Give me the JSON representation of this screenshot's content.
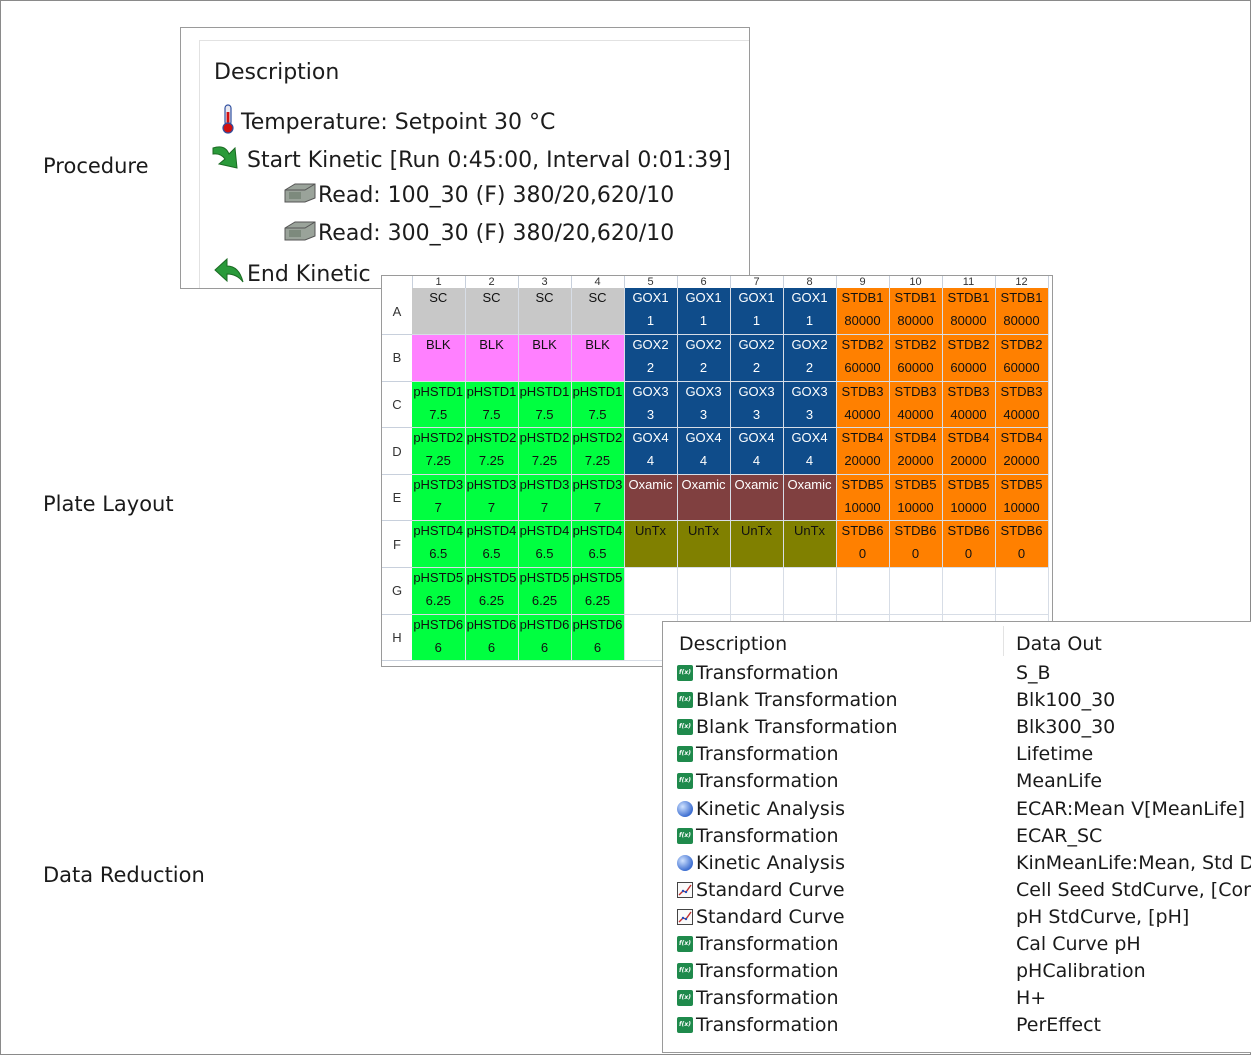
{
  "labels": {
    "procedure": "Procedure",
    "plate_layout": "Plate Layout",
    "data_reduction": "Data Reduction"
  },
  "procedure": {
    "header": "Description",
    "steps": [
      {
        "icon": "thermometer-icon",
        "text": "Temperature:  Setpoint 30 °C"
      },
      {
        "icon": "start-kinetic-arrow-icon",
        "text": "Start Kinetic [Run 0:45:00, Interval 0:01:39]"
      },
      {
        "icon": "read-icon",
        "text": "Read:  100_30 (F) 380/20,620/10"
      },
      {
        "icon": "read-icon",
        "text": "Read:  300_30 (F) 380/20,620/10"
      },
      {
        "icon": "end-kinetic-arrow-icon",
        "text": "End Kinetic"
      }
    ]
  },
  "plate": {
    "columns": [
      "1",
      "2",
      "3",
      "4",
      "5",
      "6",
      "7",
      "8",
      "9",
      "10",
      "11",
      "12"
    ],
    "rows": [
      {
        "label": "A",
        "wells": [
          {
            "l1": "SC",
            "l2": "",
            "c": "#c8c8c8"
          },
          {
            "l1": "SC",
            "l2": "",
            "c": "#c8c8c8"
          },
          {
            "l1": "SC",
            "l2": "",
            "c": "#c8c8c8"
          },
          {
            "l1": "SC",
            "l2": "",
            "c": "#c8c8c8"
          },
          {
            "l1": "GOX1",
            "l2": "1",
            "c": "#0f4c8a"
          },
          {
            "l1": "GOX1",
            "l2": "1",
            "c": "#0f4c8a"
          },
          {
            "l1": "GOX1",
            "l2": "1",
            "c": "#0f4c8a"
          },
          {
            "l1": "GOX1",
            "l2": "1",
            "c": "#0f4c8a"
          },
          {
            "l1": "STDB1",
            "l2": "80000",
            "c": "#ff8000"
          },
          {
            "l1": "STDB1",
            "l2": "80000",
            "c": "#ff8000"
          },
          {
            "l1": "STDB1",
            "l2": "80000",
            "c": "#ff8000"
          },
          {
            "l1": "STDB1",
            "l2": "80000",
            "c": "#ff8000"
          }
        ]
      },
      {
        "label": "B",
        "wells": [
          {
            "l1": "BLK",
            "l2": "",
            "c": "#ff80ff"
          },
          {
            "l1": "BLK",
            "l2": "",
            "c": "#ff80ff"
          },
          {
            "l1": "BLK",
            "l2": "",
            "c": "#ff80ff"
          },
          {
            "l1": "BLK",
            "l2": "",
            "c": "#ff80ff"
          },
          {
            "l1": "GOX2",
            "l2": "2",
            "c": "#0f4c8a"
          },
          {
            "l1": "GOX2",
            "l2": "2",
            "c": "#0f4c8a"
          },
          {
            "l1": "GOX2",
            "l2": "2",
            "c": "#0f4c8a"
          },
          {
            "l1": "GOX2",
            "l2": "2",
            "c": "#0f4c8a"
          },
          {
            "l1": "STDB2",
            "l2": "60000",
            "c": "#ff8000"
          },
          {
            "l1": "STDB2",
            "l2": "60000",
            "c": "#ff8000"
          },
          {
            "l1": "STDB2",
            "l2": "60000",
            "c": "#ff8000"
          },
          {
            "l1": "STDB2",
            "l2": "60000",
            "c": "#ff8000"
          }
        ]
      },
      {
        "label": "C",
        "wells": [
          {
            "l1": "pHSTD1",
            "l2": "7.5",
            "c": "#00ff40"
          },
          {
            "l1": "pHSTD1",
            "l2": "7.5",
            "c": "#00ff40"
          },
          {
            "l1": "pHSTD1",
            "l2": "7.5",
            "c": "#00ff40"
          },
          {
            "l1": "pHSTD1",
            "l2": "7.5",
            "c": "#00ff40"
          },
          {
            "l1": "GOX3",
            "l2": "3",
            "c": "#0f4c8a"
          },
          {
            "l1": "GOX3",
            "l2": "3",
            "c": "#0f4c8a"
          },
          {
            "l1": "GOX3",
            "l2": "3",
            "c": "#0f4c8a"
          },
          {
            "l1": "GOX3",
            "l2": "3",
            "c": "#0f4c8a"
          },
          {
            "l1": "STDB3",
            "l2": "40000",
            "c": "#ff8000"
          },
          {
            "l1": "STDB3",
            "l2": "40000",
            "c": "#ff8000"
          },
          {
            "l1": "STDB3",
            "l2": "40000",
            "c": "#ff8000"
          },
          {
            "l1": "STDB3",
            "l2": "40000",
            "c": "#ff8000"
          }
        ]
      },
      {
        "label": "D",
        "wells": [
          {
            "l1": "pHSTD2",
            "l2": "7.25",
            "c": "#00ff40"
          },
          {
            "l1": "pHSTD2",
            "l2": "7.25",
            "c": "#00ff40"
          },
          {
            "l1": "pHSTD2",
            "l2": "7.25",
            "c": "#00ff40"
          },
          {
            "l1": "pHSTD2",
            "l2": "7.25",
            "c": "#00ff40"
          },
          {
            "l1": "GOX4",
            "l2": "4",
            "c": "#0f4c8a"
          },
          {
            "l1": "GOX4",
            "l2": "4",
            "c": "#0f4c8a"
          },
          {
            "l1": "GOX4",
            "l2": "4",
            "c": "#0f4c8a"
          },
          {
            "l1": "GOX4",
            "l2": "4",
            "c": "#0f4c8a"
          },
          {
            "l1": "STDB4",
            "l2": "20000",
            "c": "#ff8000"
          },
          {
            "l1": "STDB4",
            "l2": "20000",
            "c": "#ff8000"
          },
          {
            "l1": "STDB4",
            "l2": "20000",
            "c": "#ff8000"
          },
          {
            "l1": "STDB4",
            "l2": "20000",
            "c": "#ff8000"
          }
        ]
      },
      {
        "label": "E",
        "wells": [
          {
            "l1": "pHSTD3",
            "l2": "7",
            "c": "#00ff40"
          },
          {
            "l1": "pHSTD3",
            "l2": "7",
            "c": "#00ff40"
          },
          {
            "l1": "pHSTD3",
            "l2": "7",
            "c": "#00ff40"
          },
          {
            "l1": "pHSTD3",
            "l2": "7",
            "c": "#00ff40"
          },
          {
            "l1": "Oxamic",
            "l2": "",
            "c": "#804040"
          },
          {
            "l1": "Oxamic",
            "l2": "",
            "c": "#804040"
          },
          {
            "l1": "Oxamic",
            "l2": "",
            "c": "#804040"
          },
          {
            "l1": "Oxamic",
            "l2": "",
            "c": "#804040"
          },
          {
            "l1": "STDB5",
            "l2": "10000",
            "c": "#ff8000"
          },
          {
            "l1": "STDB5",
            "l2": "10000",
            "c": "#ff8000"
          },
          {
            "l1": "STDB5",
            "l2": "10000",
            "c": "#ff8000"
          },
          {
            "l1": "STDB5",
            "l2": "10000",
            "c": "#ff8000"
          }
        ]
      },
      {
        "label": "F",
        "wells": [
          {
            "l1": "pHSTD4",
            "l2": "6.5",
            "c": "#00ff40"
          },
          {
            "l1": "pHSTD4",
            "l2": "6.5",
            "c": "#00ff40"
          },
          {
            "l1": "pHSTD4",
            "l2": "6.5",
            "c": "#00ff40"
          },
          {
            "l1": "pHSTD4",
            "l2": "6.5",
            "c": "#00ff40"
          },
          {
            "l1": "UnTx",
            "l2": "",
            "c": "#808000"
          },
          {
            "l1": "UnTx",
            "l2": "",
            "c": "#808000"
          },
          {
            "l1": "UnTx",
            "l2": "",
            "c": "#808000"
          },
          {
            "l1": "UnTx",
            "l2": "",
            "c": "#808000"
          },
          {
            "l1": "STDB6",
            "l2": "0",
            "c": "#ff8000"
          },
          {
            "l1": "STDB6",
            "l2": "0",
            "c": "#ff8000"
          },
          {
            "l1": "STDB6",
            "l2": "0",
            "c": "#ff8000"
          },
          {
            "l1": "STDB6",
            "l2": "0",
            "c": "#ff8000"
          }
        ]
      },
      {
        "label": "G",
        "wells": [
          {
            "l1": "pHSTD5",
            "l2": "6.25",
            "c": "#00ff40"
          },
          {
            "l1": "pHSTD5",
            "l2": "6.25",
            "c": "#00ff40"
          },
          {
            "l1": "pHSTD5",
            "l2": "6.25",
            "c": "#00ff40"
          },
          {
            "l1": "pHSTD5",
            "l2": "6.25",
            "c": "#00ff40"
          },
          {
            "l1": "",
            "l2": "",
            "c": "#ffffff"
          },
          {
            "l1": "",
            "l2": "",
            "c": "#ffffff"
          },
          {
            "l1": "",
            "l2": "",
            "c": "#ffffff"
          },
          {
            "l1": "",
            "l2": "",
            "c": "#ffffff"
          },
          {
            "l1": "",
            "l2": "",
            "c": "#ffffff"
          },
          {
            "l1": "",
            "l2": "",
            "c": "#ffffff"
          },
          {
            "l1": "",
            "l2": "",
            "c": "#ffffff"
          },
          {
            "l1": "",
            "l2": "",
            "c": "#ffffff"
          }
        ]
      },
      {
        "label": "H",
        "wells": [
          {
            "l1": "pHSTD6",
            "l2": "6",
            "c": "#00ff40"
          },
          {
            "l1": "pHSTD6",
            "l2": "6",
            "c": "#00ff40"
          },
          {
            "l1": "pHSTD6",
            "l2": "6",
            "c": "#00ff40"
          },
          {
            "l1": "pHSTD6",
            "l2": "6",
            "c": "#00ff40"
          },
          {
            "l1": "",
            "l2": "",
            "c": "#ffffff"
          },
          {
            "l1": "",
            "l2": "",
            "c": "#ffffff"
          },
          {
            "l1": "",
            "l2": "",
            "c": "#ffffff"
          },
          {
            "l1": "",
            "l2": "",
            "c": "#ffffff"
          },
          {
            "l1": "",
            "l2": "",
            "c": "#ffffff"
          },
          {
            "l1": "",
            "l2": "",
            "c": "#ffffff"
          },
          {
            "l1": "",
            "l2": "",
            "c": "#ffffff"
          },
          {
            "l1": "",
            "l2": "",
            "c": "#ffffff"
          }
        ]
      }
    ]
  },
  "data_reduction": {
    "header_description": "Description",
    "header_data_out": "Data Out",
    "rows": [
      {
        "icon": "transformation-icon",
        "description": "Transformation",
        "data_out": "S_B"
      },
      {
        "icon": "transformation-icon",
        "description": "Blank Transformation",
        "data_out": "Blk100_30"
      },
      {
        "icon": "transformation-icon",
        "description": "Blank Transformation",
        "data_out": "Blk300_30"
      },
      {
        "icon": "transformation-icon",
        "description": "Transformation",
        "data_out": "Lifetime"
      },
      {
        "icon": "transformation-icon",
        "description": "Transformation",
        "data_out": "MeanLife"
      },
      {
        "icon": "kinetic-analysis-icon",
        "description": "Kinetic Analysis",
        "data_out": "ECAR:Mean V[MeanLife]"
      },
      {
        "icon": "transformation-icon",
        "description": "Transformation",
        "data_out": "ECAR_SC"
      },
      {
        "icon": "kinetic-analysis-icon",
        "description": "Kinetic Analysis",
        "data_out": "KinMeanLife:Mean, Std De..."
      },
      {
        "icon": "standard-curve-icon",
        "description": "Standard Curve",
        "data_out": "Cell Seed StdCurve, [Conc..."
      },
      {
        "icon": "standard-curve-icon",
        "description": "Standard Curve",
        "data_out": "pH StdCurve, [pH]"
      },
      {
        "icon": "transformation-icon",
        "description": "Transformation",
        "data_out": "Cal Curve pH"
      },
      {
        "icon": "transformation-icon",
        "description": "Transformation",
        "data_out": "pHCalibration"
      },
      {
        "icon": "transformation-icon",
        "description": "Transformation",
        "data_out": "H+"
      },
      {
        "icon": "transformation-icon",
        "description": "Transformation",
        "data_out": "PerEffect"
      }
    ]
  }
}
